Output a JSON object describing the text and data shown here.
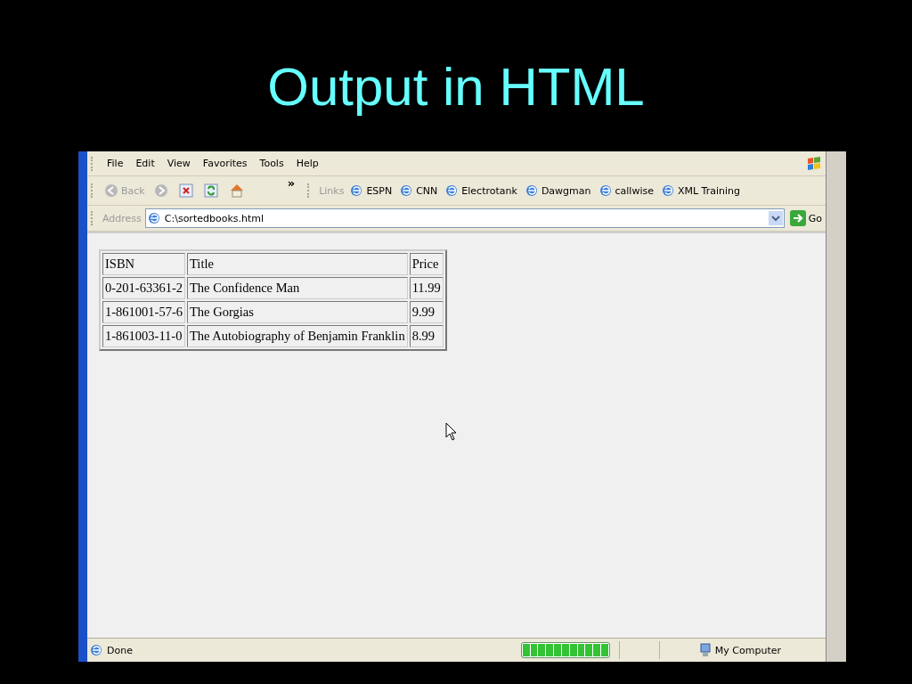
{
  "slide": {
    "title": "Output in HTML"
  },
  "browser": {
    "menu": [
      "File",
      "Edit",
      "View",
      "Favorites",
      "Tools",
      "Help"
    ],
    "toolbar": {
      "back": "Back",
      "more": "»",
      "links_label": "Links",
      "links": [
        "ESPN",
        "CNN",
        "Electrotank",
        "Dawgman",
        "callwise",
        "XML Training"
      ]
    },
    "address": {
      "label": "Address",
      "value": "C:\\sortedbooks.html",
      "go": "Go"
    },
    "table": {
      "columns": [
        "ISBN",
        "Title",
        "Price"
      ],
      "rows": [
        [
          "0-201-63361-2",
          "The Confidence Man",
          "11.99"
        ],
        [
          "1-861001-57-6",
          "The Gorgias",
          "9.99"
        ],
        [
          "1-861003-11-0",
          "The Autobiography of Benjamin Franklin",
          "8.99"
        ]
      ]
    },
    "status_bar": {
      "text": "Done",
      "progress": {
        "level": 1
      },
      "zone": "My Computer"
    }
  }
}
